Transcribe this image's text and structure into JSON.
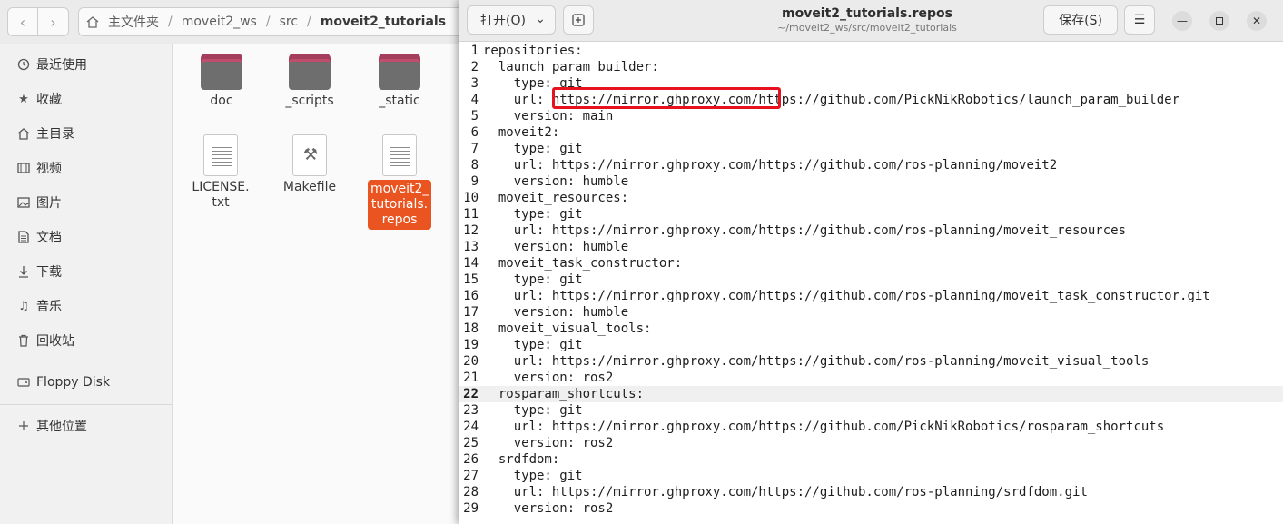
{
  "file_manager": {
    "breadcrumb": [
      "主文件夹",
      "moveit2_ws",
      "src",
      "moveit2_tutorials"
    ],
    "sidebar": [
      {
        "label": "最近使用",
        "icon": "clock-icon"
      },
      {
        "label": "收藏",
        "icon": "star-icon"
      },
      {
        "label": "主目录",
        "icon": "home-icon"
      },
      {
        "label": "视频",
        "icon": "film-icon"
      },
      {
        "label": "图片",
        "icon": "image-icon"
      },
      {
        "label": "文档",
        "icon": "document-icon"
      },
      {
        "label": "下载",
        "icon": "download-icon"
      },
      {
        "label": "音乐",
        "icon": "music-icon"
      },
      {
        "label": "回收站",
        "icon": "trash-icon"
      },
      {
        "label": "Floppy Disk",
        "icon": "disk-icon"
      },
      {
        "label": "其他位置",
        "icon": "plus-icon"
      }
    ],
    "files": [
      {
        "label": "doc",
        "kind": "folder"
      },
      {
        "label": "_scripts",
        "kind": "folder"
      },
      {
        "label": "_static",
        "kind": "folder"
      },
      {
        "label": "LICENSE.\ntxt",
        "kind": "text"
      },
      {
        "label": "Makefile",
        "kind": "makefile"
      },
      {
        "label": "moveit2_\ntutorials.\nrepos",
        "kind": "text",
        "selected": true
      }
    ]
  },
  "editor": {
    "open_label": "打开(O)",
    "title": "moveit2_tutorials.repos",
    "subtitle": "~/moveit2_ws/src/moveit2_tutorials",
    "save_label": "保存(S)",
    "current_line": 22,
    "lines": [
      "repositories:",
      "  launch_param_builder:",
      "    type: git",
      "    url: https://mirror.ghproxy.com/https://github.com/PickNikRobotics/launch_param_builder",
      "    version: main",
      "  moveit2:",
      "    type: git",
      "    url: https://mirror.ghproxy.com/https://github.com/ros-planning/moveit2",
      "    version: humble",
      "  moveit_resources:",
      "    type: git",
      "    url: https://mirror.ghproxy.com/https://github.com/ros-planning/moveit_resources",
      "    version: humble",
      "  moveit_task_constructor:",
      "    type: git",
      "    url: https://mirror.ghproxy.com/https://github.com/ros-planning/moveit_task_constructor.git",
      "    version: humble",
      "  moveit_visual_tools:",
      "    type: git",
      "    url: https://mirror.ghproxy.com/https://github.com/ros-planning/moveit_visual_tools",
      "    version: ros2",
      "  rosparam_shortcuts:",
      "    type: git",
      "    url: https://mirror.ghproxy.com/https://github.com/PickNikRobotics/rosparam_shortcuts",
      "    version: ros2",
      "  srdfdom:",
      "    type: git",
      "    url: https://mirror.ghproxy.com/https://github.com/ros-planning/srdfdom.git",
      "    version: ros2"
    ],
    "highlight_color": "#e8121e"
  }
}
